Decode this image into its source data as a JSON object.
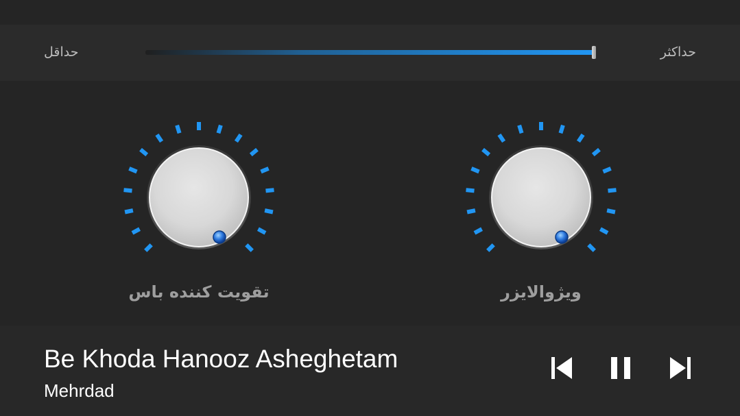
{
  "volume": {
    "min_label": "حداقل",
    "max_label": "حداکثر",
    "level": 1.0
  },
  "knobs": {
    "bass_boost": {
      "label": "تقویت کننده باس",
      "icon": "knob-icon"
    },
    "visualizer": {
      "label": "ویژوالایزر",
      "icon": "knob-icon"
    }
  },
  "player": {
    "title": "Be Khoda Hanooz Asheghetam",
    "artist": "Mehrdad",
    "controls": {
      "previous_icon": "skip-previous-icon",
      "pause_icon": "pause-icon",
      "next_icon": "skip-next-icon"
    }
  },
  "colors": {
    "accent": "#2196f3",
    "background": "#252525",
    "panel": "#2b2b2b",
    "label": "#9e9e9e"
  }
}
